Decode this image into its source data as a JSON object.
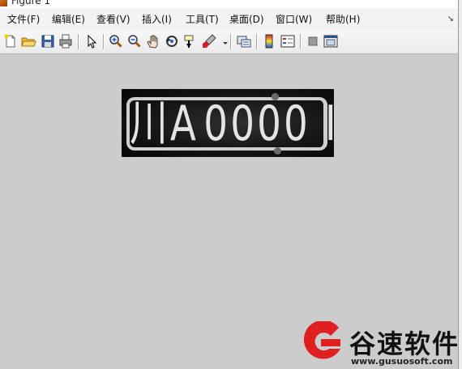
{
  "window": {
    "title": "Figure 1"
  },
  "menu": {
    "items": [
      "文件(F)",
      "编辑(E)",
      "查看(V)",
      "插入(I)",
      "工具(T)",
      "桌面(D)",
      "窗口(W)",
      "帮助(H)"
    ],
    "overflow_glyph": "↘"
  },
  "toolbar": {
    "buttons": [
      "new-figure-icon",
      "open-file-icon",
      "save-icon",
      "print-icon",
      "edit-plot-arrow-icon",
      "zoom-in-icon",
      "zoom-out-icon",
      "pan-hand-icon",
      "rotate-3d-icon",
      "data-cursor-icon",
      "brush-icon",
      "brush-dropdown-icon",
      "link-plot-icon",
      "insert-colorbar-icon",
      "insert-legend-icon",
      "hide-plot-tools-icon",
      "show-plot-tools-icon"
    ]
  },
  "figure": {
    "image": {
      "plate_text_part1": "川A",
      "plate_text_part2": "0000 I"
    }
  },
  "watermark": {
    "brand": "谷速软件",
    "url": "www.gusuosoft.com",
    "accent": "#e02020"
  }
}
